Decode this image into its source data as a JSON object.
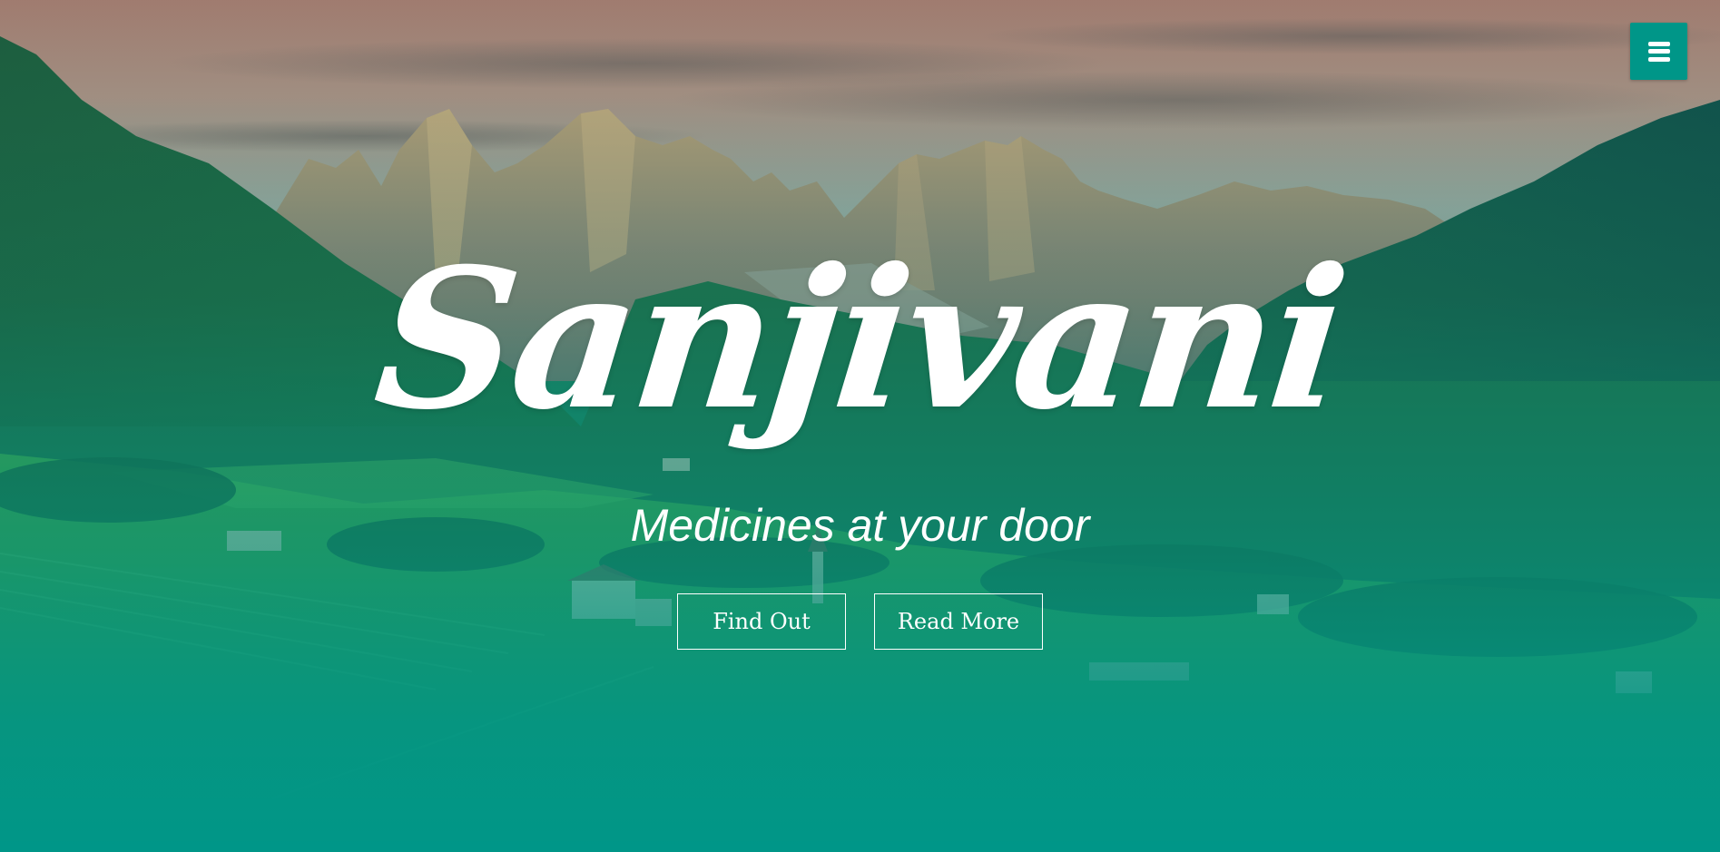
{
  "nav": {
    "menu_icon": "hamburger-icon",
    "accent_color": "#009688"
  },
  "hero": {
    "title": "Sanjivani",
    "tagline": "Medicines at your door",
    "buttons": {
      "find_out_label": "Find Out",
      "read_more_label": "Read More"
    },
    "overlay_color": "#009688"
  }
}
